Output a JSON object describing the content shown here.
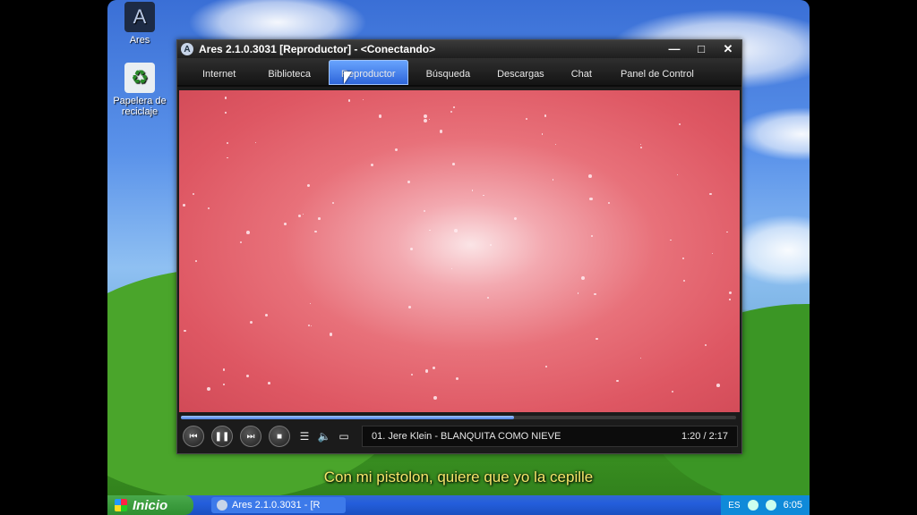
{
  "desktop": {
    "icons": [
      {
        "label": "Ares",
        "icon": "ares-icon"
      },
      {
        "label": "Papelera de reciclaje",
        "icon": "recycle-bin-icon"
      }
    ]
  },
  "window": {
    "title": "Ares 2.1.0.3031  [Reproductor]  -  <Conectando>",
    "controls": {
      "minimize": "—",
      "maximize": "□",
      "close": "✕"
    },
    "tabs": [
      {
        "label": "Internet"
      },
      {
        "label": "Biblioteca"
      },
      {
        "label": "Reproductor",
        "active": true
      },
      {
        "label": "Búsqueda"
      },
      {
        "label": "Descargas"
      },
      {
        "label": "Chat"
      },
      {
        "label": "Panel de Control"
      }
    ]
  },
  "player": {
    "progress": 0.6,
    "track": "01. Jere Klein - BLANQUITA COMO NIEVE",
    "time": "1:20 / 2:17",
    "buttons": {
      "prev": "⏮",
      "pause": "❚❚",
      "next": "⏭",
      "stop": "■",
      "playlist": "☰",
      "volume": "🔈",
      "fullscreen": "▭"
    }
  },
  "subtitle": "Con mi pistolon, quiere que yo la cepille",
  "taskbar": {
    "start_label": "Inicio",
    "task_label": "Ares 2.1.0.3031 - [R",
    "lang": "ES",
    "clock": "6:05"
  },
  "colors": {
    "accent": "#2c63d9",
    "video": "#e8717a",
    "subtitle": "#f5e66a"
  }
}
